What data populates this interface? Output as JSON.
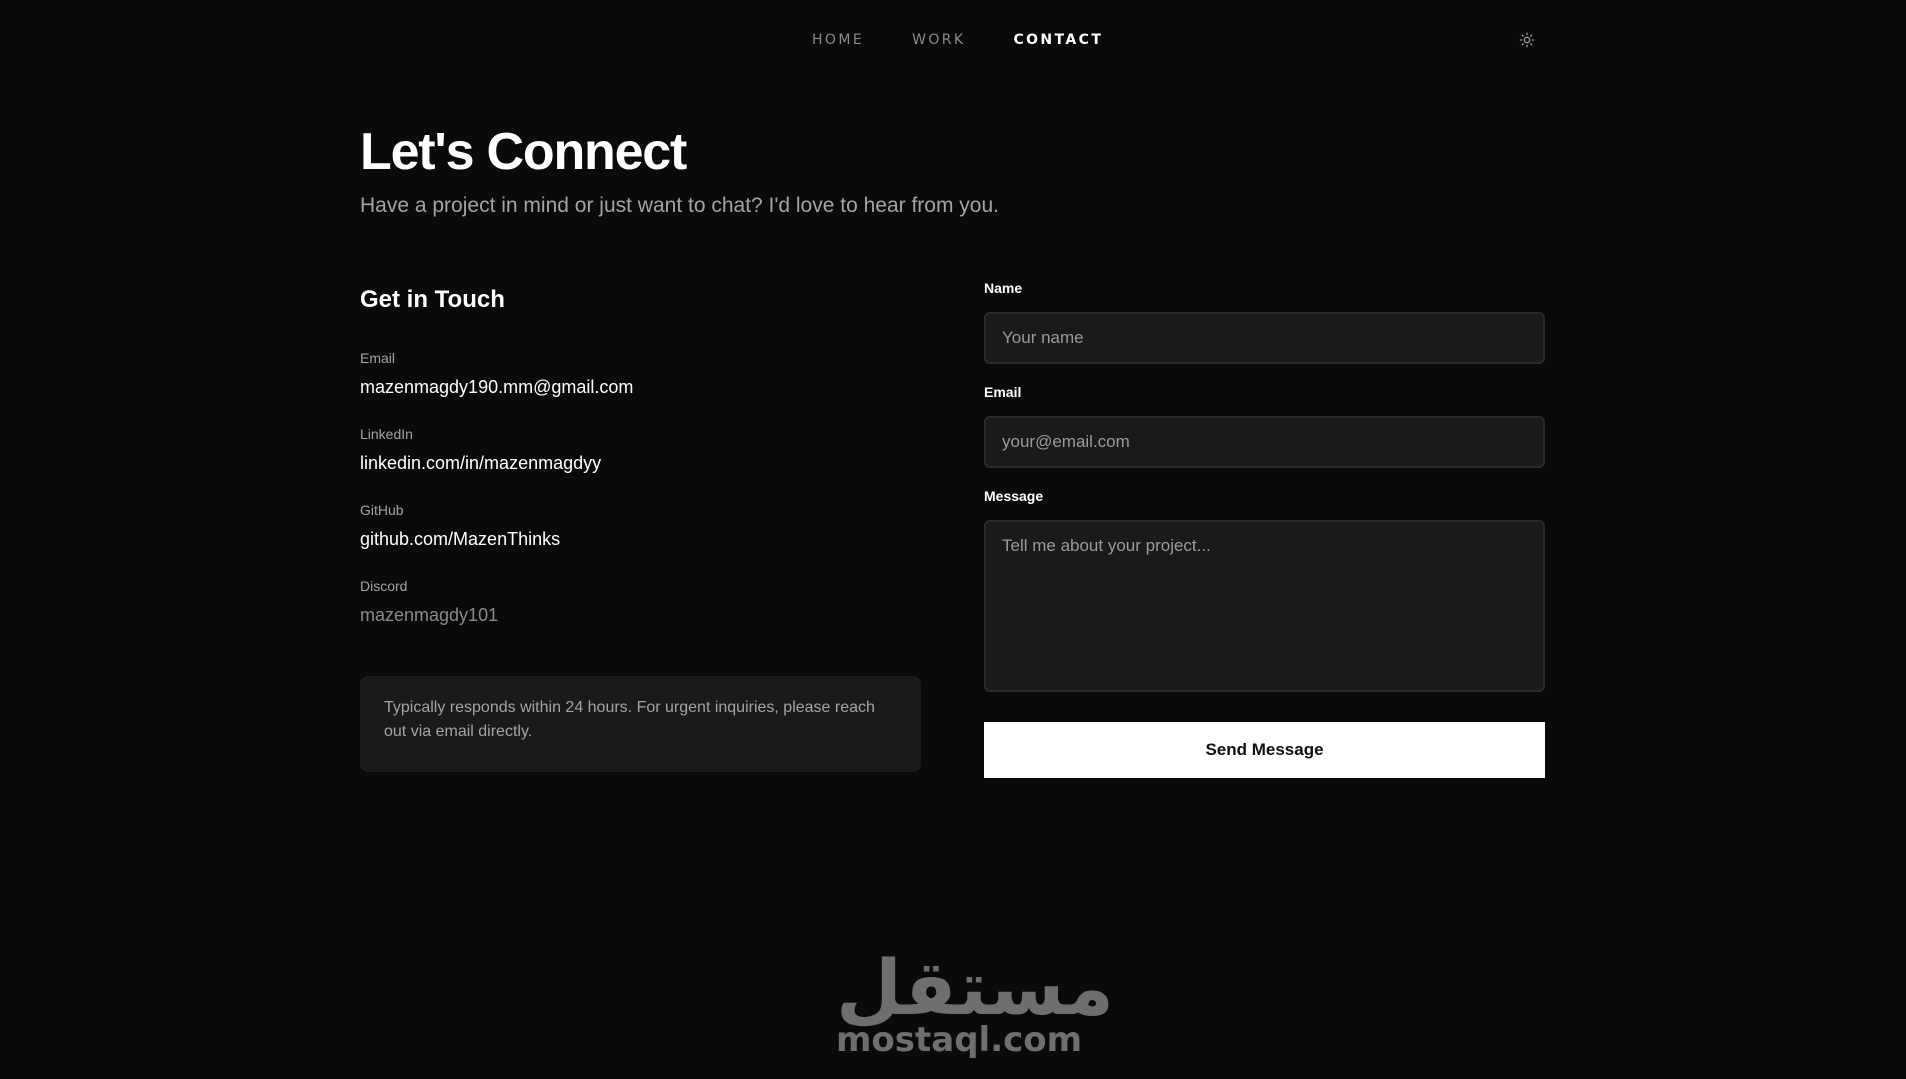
{
  "nav": {
    "items": [
      {
        "label": "HOME",
        "active": false
      },
      {
        "label": "WORK",
        "active": false
      },
      {
        "label": "CONTACT",
        "active": true
      }
    ],
    "theme_icon": "sun-icon"
  },
  "hero": {
    "title": "Let's Connect",
    "subtitle": "Have a project in mind or just want to chat? I'd love to hear from you."
  },
  "contact_info": {
    "title": "Get in Touch",
    "items": [
      {
        "label": "Email",
        "value": "mazenmagdy190.mm@gmail.com"
      },
      {
        "label": "LinkedIn",
        "value": "linkedin.com/in/mazenmagdyy"
      },
      {
        "label": "GitHub",
        "value": "github.com/MazenThinks"
      },
      {
        "label": "Discord",
        "value": "mazenmagdy101"
      }
    ],
    "note": "Typically responds within 24 hours. For urgent inquiries, please reach out via email directly."
  },
  "form": {
    "name_label": "Name",
    "name_placeholder": "Your name",
    "email_label": "Email",
    "email_placeholder": "your@email.com",
    "message_label": "Message",
    "message_placeholder": "Tell me about your project...",
    "submit_label": "Send Message"
  },
  "watermark": {
    "arabic": "مستقل",
    "latin": "mostaql.com"
  },
  "colors": {
    "background": "#0a0a0a",
    "surface": "#1a1a1a",
    "text": "#ffffff",
    "muted": "#a3a3a3"
  }
}
